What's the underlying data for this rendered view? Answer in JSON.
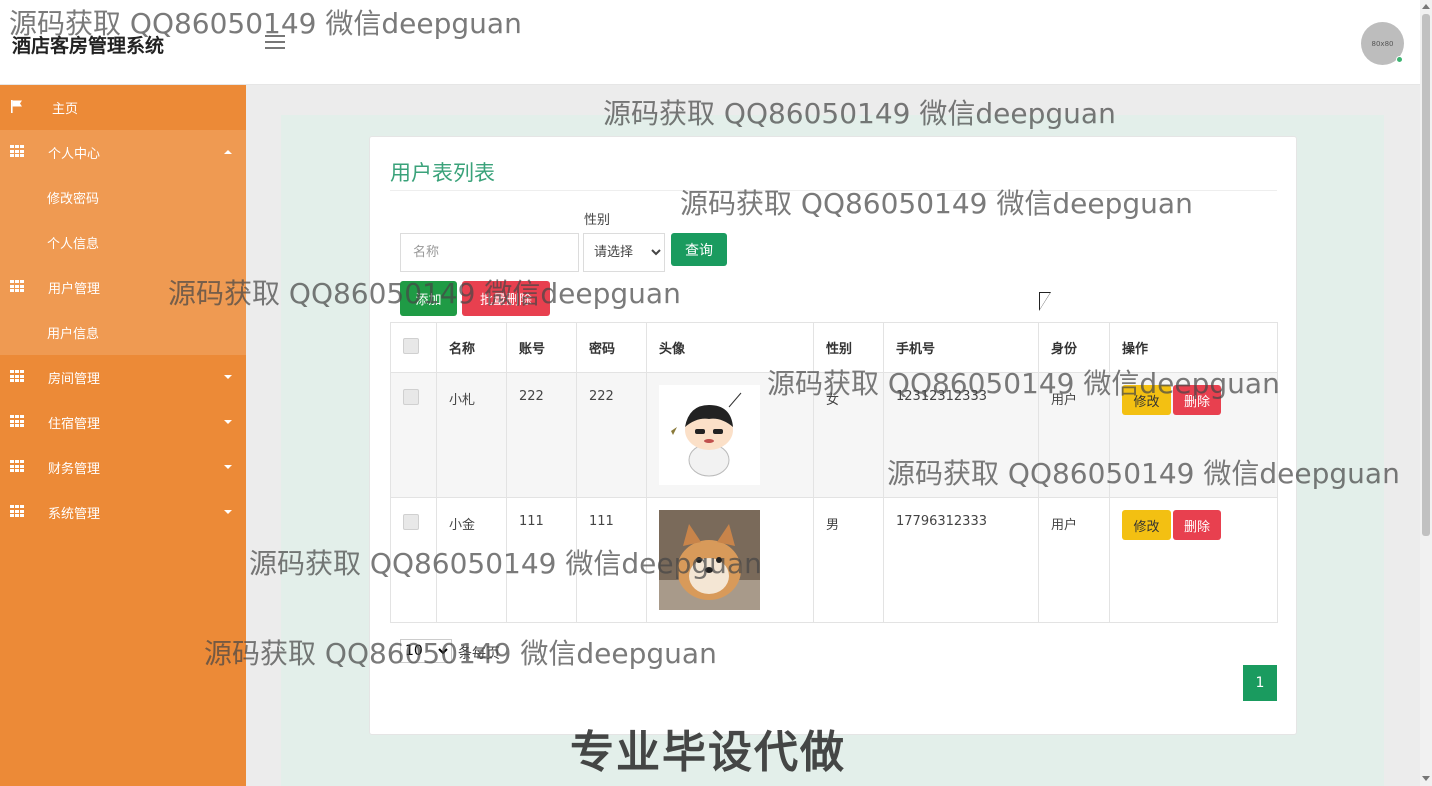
{
  "header": {
    "app_title": "酒店客房管理系统",
    "avatar_text": "80x80"
  },
  "sidebar": {
    "items": [
      {
        "label": "主页",
        "icon": "flag-icon"
      },
      {
        "label": "个人中心",
        "icon": "grid-icon",
        "expanded": true,
        "children": [
          "修改密码",
          "个人信息"
        ]
      },
      {
        "label": "用户管理",
        "icon": "grid-icon",
        "expanded": true,
        "children": [
          "用户信息"
        ]
      },
      {
        "label": "房间管理",
        "icon": "grid-icon"
      },
      {
        "label": "住宿管理",
        "icon": "grid-icon"
      },
      {
        "label": "财务管理",
        "icon": "grid-icon"
      },
      {
        "label": "系统管理",
        "icon": "grid-icon"
      }
    ]
  },
  "main": {
    "title": "用户表列表",
    "search": {
      "name_placeholder": "名称",
      "gender_label": "性别",
      "gender_selected": "请选择",
      "query_label": "查询"
    },
    "actions": {
      "add_label": "添加",
      "bulk_delete_label": "批量删除"
    },
    "table": {
      "columns": [
        "名称",
        "账号",
        "密码",
        "头像",
        "性别",
        "手机号",
        "身份",
        "操作"
      ],
      "rows": [
        {
          "name": "小札",
          "account": "222",
          "password": "222",
          "avatar": "cartoon-boy",
          "gender": "女",
          "phone": "12312312333",
          "role": "用户"
        },
        {
          "name": "小金",
          "account": "111",
          "password": "111",
          "avatar": "shiba-dog",
          "gender": "男",
          "phone": "17796312333",
          "role": "用户"
        }
      ],
      "edit_label": "修改",
      "delete_label": "删除"
    },
    "pagination": {
      "page_size": "10",
      "page_size_suffix": "条每页",
      "current_page": "1"
    }
  },
  "watermark": {
    "text": "源码获取 QQ86050149 微信deepguan",
    "banner": "专业毕设代做"
  },
  "colors": {
    "sidebar": "#ec8a37",
    "accent_green": "#1a9b5f",
    "danger": "#e8404f",
    "warning": "#f3c012",
    "title_green": "#3aa27a"
  }
}
